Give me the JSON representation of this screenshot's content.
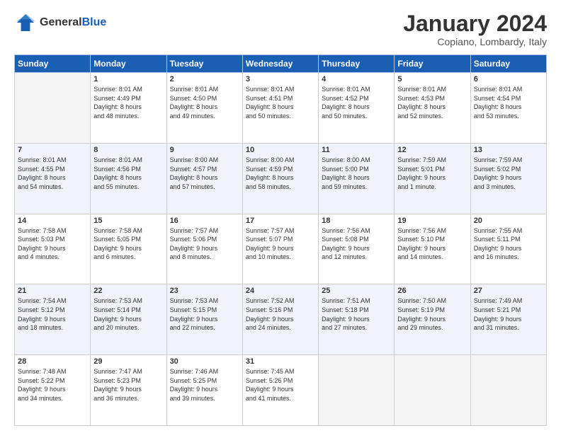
{
  "header": {
    "logo_line1": "General",
    "logo_line2": "Blue",
    "month": "January 2024",
    "location": "Copiano, Lombardy, Italy"
  },
  "weekdays": [
    "Sunday",
    "Monday",
    "Tuesday",
    "Wednesday",
    "Thursday",
    "Friday",
    "Saturday"
  ],
  "weeks": [
    [
      {
        "day": "",
        "info": ""
      },
      {
        "day": "1",
        "info": "Sunrise: 8:01 AM\nSunset: 4:49 PM\nDaylight: 8 hours\nand 48 minutes."
      },
      {
        "day": "2",
        "info": "Sunrise: 8:01 AM\nSunset: 4:50 PM\nDaylight: 8 hours\nand 49 minutes."
      },
      {
        "day": "3",
        "info": "Sunrise: 8:01 AM\nSunset: 4:51 PM\nDaylight: 8 hours\nand 50 minutes."
      },
      {
        "day": "4",
        "info": "Sunrise: 8:01 AM\nSunset: 4:52 PM\nDaylight: 8 hours\nand 50 minutes."
      },
      {
        "day": "5",
        "info": "Sunrise: 8:01 AM\nSunset: 4:53 PM\nDaylight: 8 hours\nand 52 minutes."
      },
      {
        "day": "6",
        "info": "Sunrise: 8:01 AM\nSunset: 4:54 PM\nDaylight: 8 hours\nand 53 minutes."
      }
    ],
    [
      {
        "day": "7",
        "info": "Sunrise: 8:01 AM\nSunset: 4:55 PM\nDaylight: 8 hours\nand 54 minutes."
      },
      {
        "day": "8",
        "info": "Sunrise: 8:01 AM\nSunset: 4:56 PM\nDaylight: 8 hours\nand 55 minutes."
      },
      {
        "day": "9",
        "info": "Sunrise: 8:00 AM\nSunset: 4:57 PM\nDaylight: 8 hours\nand 57 minutes."
      },
      {
        "day": "10",
        "info": "Sunrise: 8:00 AM\nSunset: 4:59 PM\nDaylight: 8 hours\nand 58 minutes."
      },
      {
        "day": "11",
        "info": "Sunrise: 8:00 AM\nSunset: 5:00 PM\nDaylight: 8 hours\nand 59 minutes."
      },
      {
        "day": "12",
        "info": "Sunrise: 7:59 AM\nSunset: 5:01 PM\nDaylight: 9 hours\nand 1 minute."
      },
      {
        "day": "13",
        "info": "Sunrise: 7:59 AM\nSunset: 5:02 PM\nDaylight: 9 hours\nand 3 minutes."
      }
    ],
    [
      {
        "day": "14",
        "info": "Sunrise: 7:58 AM\nSunset: 5:03 PM\nDaylight: 9 hours\nand 4 minutes."
      },
      {
        "day": "15",
        "info": "Sunrise: 7:58 AM\nSunset: 5:05 PM\nDaylight: 9 hours\nand 6 minutes."
      },
      {
        "day": "16",
        "info": "Sunrise: 7:57 AM\nSunset: 5:06 PM\nDaylight: 9 hours\nand 8 minutes."
      },
      {
        "day": "17",
        "info": "Sunrise: 7:57 AM\nSunset: 5:07 PM\nDaylight: 9 hours\nand 10 minutes."
      },
      {
        "day": "18",
        "info": "Sunrise: 7:56 AM\nSunset: 5:08 PM\nDaylight: 9 hours\nand 12 minutes."
      },
      {
        "day": "19",
        "info": "Sunrise: 7:56 AM\nSunset: 5:10 PM\nDaylight: 9 hours\nand 14 minutes."
      },
      {
        "day": "20",
        "info": "Sunrise: 7:55 AM\nSunset: 5:11 PM\nDaylight: 9 hours\nand 16 minutes."
      }
    ],
    [
      {
        "day": "21",
        "info": "Sunrise: 7:54 AM\nSunset: 5:12 PM\nDaylight: 9 hours\nand 18 minutes."
      },
      {
        "day": "22",
        "info": "Sunrise: 7:53 AM\nSunset: 5:14 PM\nDaylight: 9 hours\nand 20 minutes."
      },
      {
        "day": "23",
        "info": "Sunrise: 7:53 AM\nSunset: 5:15 PM\nDaylight: 9 hours\nand 22 minutes."
      },
      {
        "day": "24",
        "info": "Sunrise: 7:52 AM\nSunset: 5:16 PM\nDaylight: 9 hours\nand 24 minutes."
      },
      {
        "day": "25",
        "info": "Sunrise: 7:51 AM\nSunset: 5:18 PM\nDaylight: 9 hours\nand 27 minutes."
      },
      {
        "day": "26",
        "info": "Sunrise: 7:50 AM\nSunset: 5:19 PM\nDaylight: 9 hours\nand 29 minutes."
      },
      {
        "day": "27",
        "info": "Sunrise: 7:49 AM\nSunset: 5:21 PM\nDaylight: 9 hours\nand 31 minutes."
      }
    ],
    [
      {
        "day": "28",
        "info": "Sunrise: 7:48 AM\nSunset: 5:22 PM\nDaylight: 9 hours\nand 34 minutes."
      },
      {
        "day": "29",
        "info": "Sunrise: 7:47 AM\nSunset: 5:23 PM\nDaylight: 9 hours\nand 36 minutes."
      },
      {
        "day": "30",
        "info": "Sunrise: 7:46 AM\nSunset: 5:25 PM\nDaylight: 9 hours\nand 39 minutes."
      },
      {
        "day": "31",
        "info": "Sunrise: 7:45 AM\nSunset: 5:26 PM\nDaylight: 9 hours\nand 41 minutes."
      },
      {
        "day": "",
        "info": ""
      },
      {
        "day": "",
        "info": ""
      },
      {
        "day": "",
        "info": ""
      }
    ]
  ]
}
